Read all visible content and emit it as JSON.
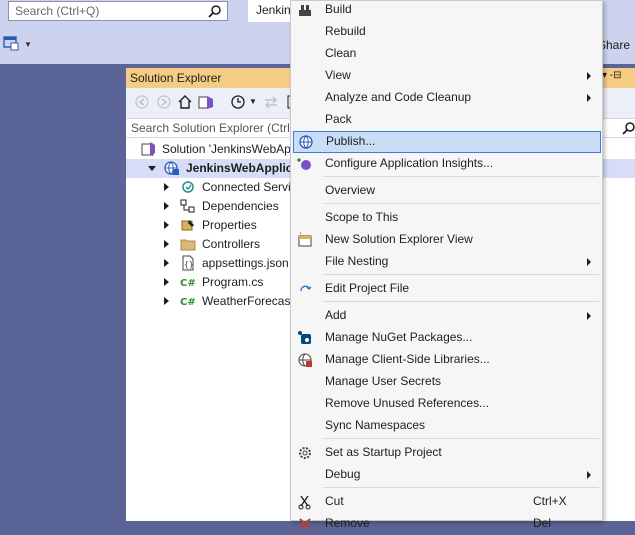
{
  "search": {
    "placeholder": "Search (Ctrl+Q)"
  },
  "title_tab": {
    "label": "Jenkins"
  },
  "toolbar": {
    "share_label": "Share"
  },
  "solution_explorer": {
    "title": "Solution Explorer",
    "header_controls": "▾ -⊟",
    "search_placeholder": "Search Solution Explorer (Ctrl+;)",
    "tree": [
      {
        "label": "Solution 'JenkinsWebApplication'",
        "icon": "solution-icon"
      },
      {
        "label": "JenkinsWebApplication",
        "icon": "web-project-icon",
        "bold": true,
        "selected": true,
        "expanded": true
      },
      {
        "label": "Connected Services",
        "icon": "connected-services-icon"
      },
      {
        "label": "Dependencies",
        "icon": "dependencies-icon"
      },
      {
        "label": "Properties",
        "icon": "properties-icon"
      },
      {
        "label": "Controllers",
        "icon": "folder-icon"
      },
      {
        "label": "appsettings.json",
        "icon": "json-file-icon"
      },
      {
        "label": "Program.cs",
        "icon": "csharp-file-icon"
      },
      {
        "label": "WeatherForecast.cs",
        "icon": "csharp-file-icon"
      }
    ]
  },
  "context_menu": {
    "items": [
      {
        "label": "Build",
        "icon": "build-icon"
      },
      {
        "label": "Rebuild"
      },
      {
        "label": "Clean"
      },
      {
        "label": "View",
        "submenu": true
      },
      {
        "label": "Analyze and Code Cleanup",
        "submenu": true
      },
      {
        "label": "Pack"
      },
      {
        "label": "Publish...",
        "icon": "publish-globe-icon",
        "highlighted": true
      },
      {
        "label": "Configure Application Insights...",
        "icon": "app-insights-icon"
      },
      {
        "label": "Overview"
      },
      {
        "label": "Scope to This"
      },
      {
        "label": "New Solution Explorer View",
        "icon": "new-view-icon"
      },
      {
        "label": "File Nesting",
        "submenu": true
      },
      {
        "label": "Edit Project File",
        "icon": "edit-project-icon"
      },
      {
        "label": "Add",
        "submenu": true
      },
      {
        "label": "Manage NuGet Packages...",
        "icon": "nuget-icon"
      },
      {
        "label": "Manage Client-Side Libraries...",
        "icon": "client-libraries-icon"
      },
      {
        "label": "Manage User Secrets"
      },
      {
        "label": "Remove Unused References..."
      },
      {
        "label": "Sync Namespaces"
      },
      {
        "label": "Set as Startup Project",
        "icon": "gear-icon"
      },
      {
        "label": "Debug",
        "submenu": true
      },
      {
        "label": "Cut",
        "icon": "scissors-icon",
        "shortcut": "Ctrl+X"
      },
      {
        "label": "Remove",
        "icon": "remove-x-icon",
        "shortcut": "Del"
      }
    ]
  },
  "colors": {
    "accent_highlight": "#c9ddf6",
    "highlight_border": "#3c7fd4",
    "panel_header": "#f5cc84",
    "ide_background": "#5b6496"
  }
}
